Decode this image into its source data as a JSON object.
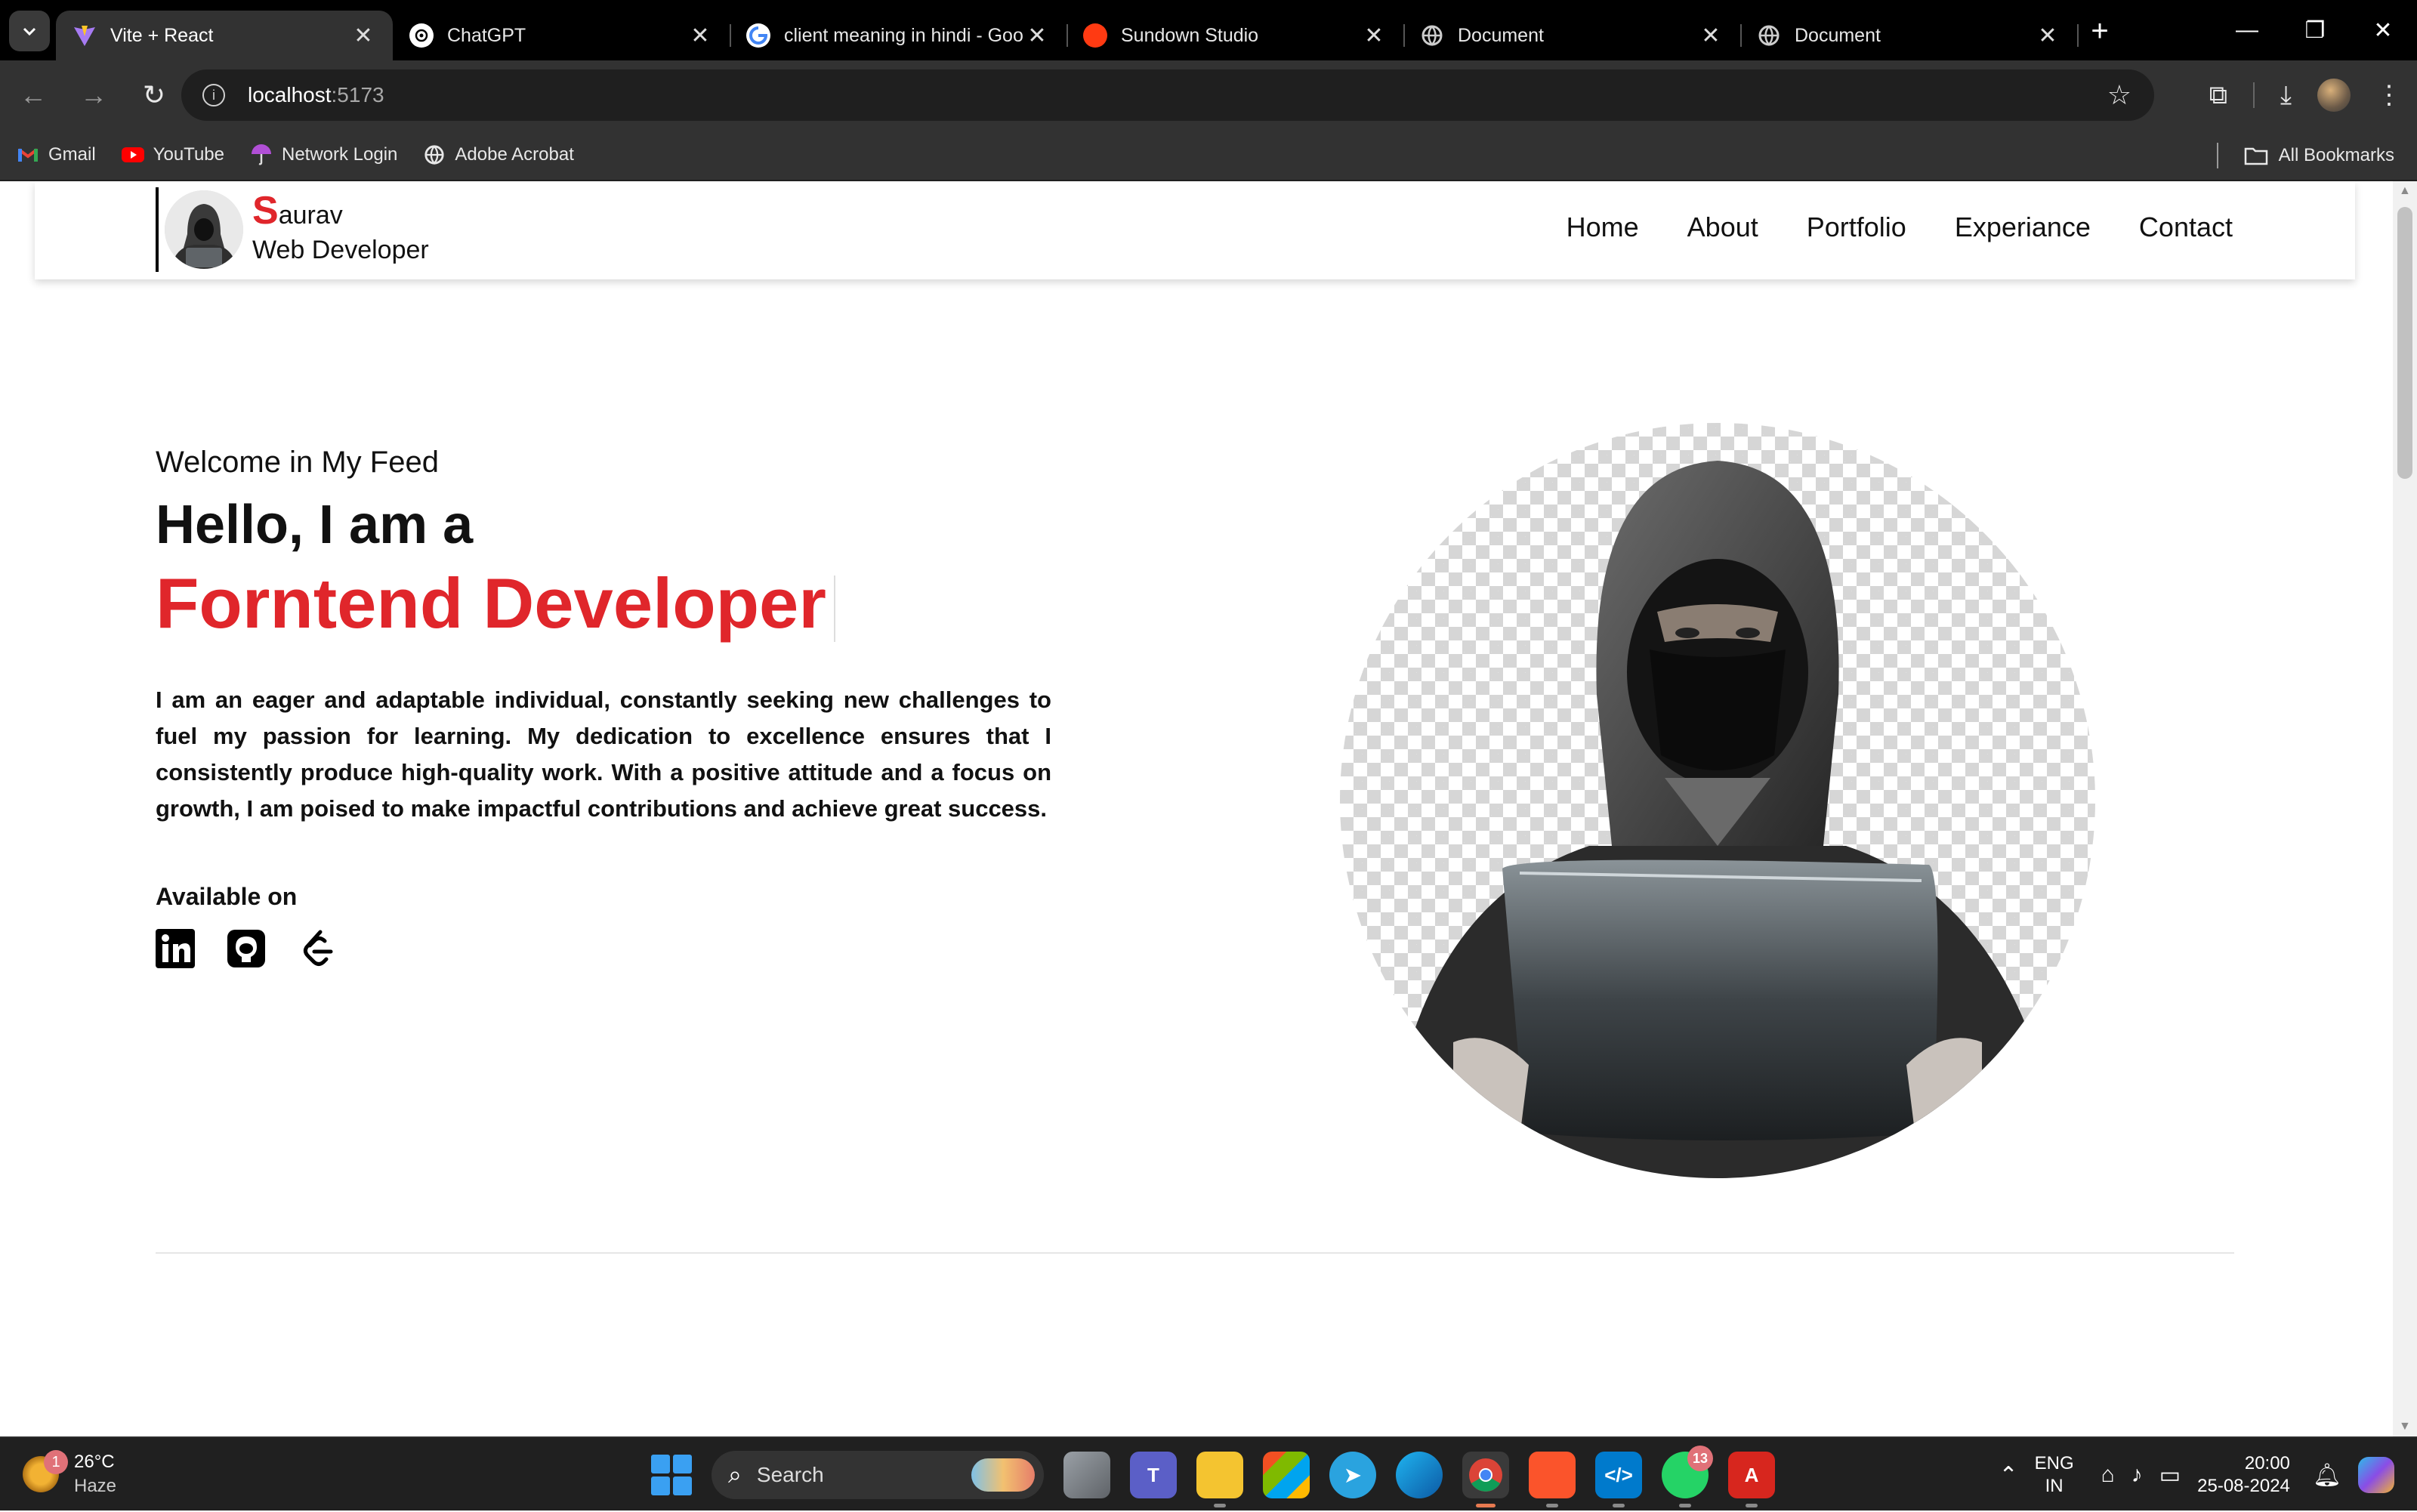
{
  "browser": {
    "tabs": [
      {
        "title": "Vite + React",
        "icon": "vite-icon",
        "active": true
      },
      {
        "title": "ChatGPT",
        "icon": "chatgpt-icon",
        "active": false
      },
      {
        "title": "client meaning in hindi - Goo",
        "icon": "google-icon",
        "active": false
      },
      {
        "title": "Sundown Studio",
        "icon": "sundown-icon",
        "active": false
      },
      {
        "title": "Document",
        "icon": "globe-icon",
        "active": false
      },
      {
        "title": "Document",
        "icon": "globe-icon",
        "active": false
      }
    ],
    "address": {
      "host": "localhost",
      "port": ":5173"
    },
    "bookmarks": [
      {
        "label": "Gmail",
        "icon": "gmail-icon"
      },
      {
        "label": "YouTube",
        "icon": "youtube-icon"
      },
      {
        "label": "Network Login",
        "icon": "umbrella-icon"
      },
      {
        "label": "Adobe Acrobat",
        "icon": "globe-icon"
      }
    ],
    "all_bookmarks": "All Bookmarks"
  },
  "site": {
    "brand": {
      "initial": "S",
      "rest": "aurav",
      "role": "Web Developer"
    },
    "nav": [
      "Home",
      "About",
      "Portfolio",
      "Experiance",
      "Contact"
    ],
    "hero": {
      "welcome": "Welcome in My Feed",
      "hello": "Hello, I am a",
      "role": "Forntend Developer",
      "bio": "I am an eager and adaptable individual, constantly seeking new challenges to fuel my passion for learning. My dedication to excellence ensures that I consistently produce high-quality work. With a positive attitude and a focus on growth, I am poised to make impactful contributions and achieve great success.",
      "available_on": "Available on",
      "socials": [
        "linkedin-icon",
        "github-icon",
        "leetcode-icon"
      ]
    }
  },
  "taskbar": {
    "weather": {
      "temp": "26°C",
      "condition": "Haze",
      "badge": "1"
    },
    "search_placeholder": "Search",
    "whatsapp_badge": "13",
    "lang": {
      "line1": "ENG",
      "line2": "IN"
    },
    "clock": {
      "time": "20:00",
      "date": "25-08-2024"
    }
  },
  "colors": {
    "accent": "#e0262b",
    "tab_bg": "#000000",
    "toolbar": "#323232"
  }
}
